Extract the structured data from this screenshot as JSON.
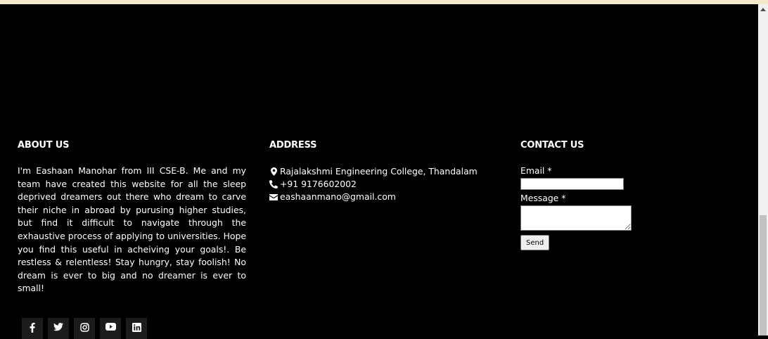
{
  "about": {
    "heading": "ABOUT US",
    "text": "I'm Eashaan Manohar from III CSE-B. Me and my team have created this website for all the sleep deprived dreamers out there who dream to carve their niche in abroad by purusing higher studies, but find it difficult to navigate through the exhaustive process of applying to universities. Hope you find this useful in acheiving your goals!. Be restless & relentless! Stay hungry, stay foolish! No dream is ever to big and no dreamer is ever to small!"
  },
  "address": {
    "heading": "ADDRESS",
    "items": [
      {
        "icon": "map-marker-icon",
        "text": "Rajalakshmi Engineering College, Thandalam"
      },
      {
        "icon": "phone-icon",
        "text": "+91 9176602002"
      },
      {
        "icon": "envelope-icon",
        "text": "eashaanmano@gmail.com"
      }
    ]
  },
  "contact": {
    "heading": "CONTACT US",
    "email_label": "Email *",
    "email_value": "",
    "message_label": "Message *",
    "message_value": "",
    "send_label": "Send"
  },
  "social": [
    "facebook-icon",
    "twitter-icon",
    "instagram-icon",
    "youtube-icon",
    "linkedin-icon"
  ],
  "colors": {
    "background": "#000000",
    "text": "#ffffff",
    "top_bar": "#f4e9c8",
    "social_bg": "#1c1c1c"
  }
}
